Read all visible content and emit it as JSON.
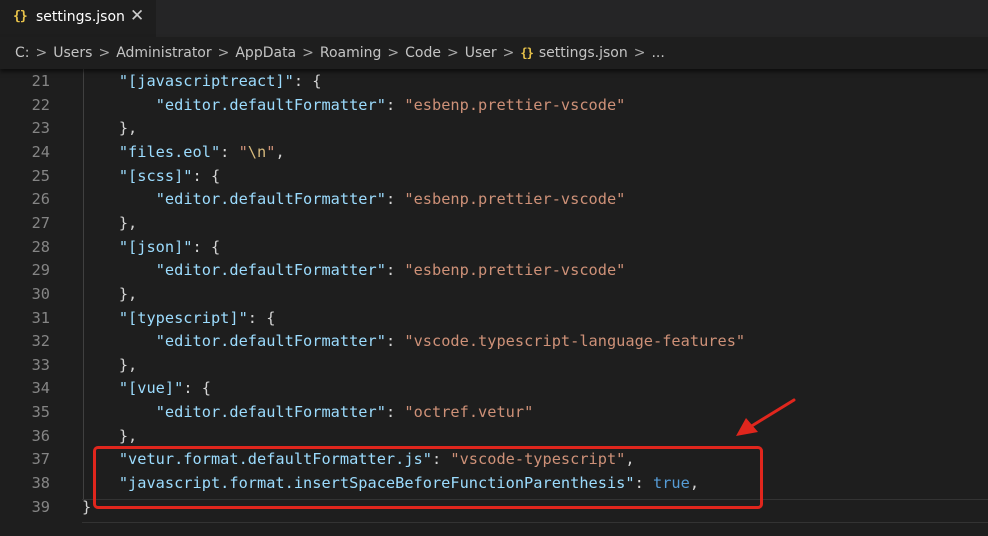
{
  "tab": {
    "icon": "{}",
    "label": "settings.json",
    "close_icon": "✕"
  },
  "breadcrumb": {
    "items": [
      "C:",
      "Users",
      "Administrator",
      "AppData",
      "Roaming",
      "Code",
      "User"
    ],
    "file_icon": "{}",
    "file": "settings.json",
    "more": "..."
  },
  "editor": {
    "lines": [
      {
        "n": "21",
        "tokens": [
          [
            "    ",
            "p"
          ],
          [
            "\"[javascriptreact]\"",
            "k"
          ],
          [
            ": {",
            "p"
          ]
        ]
      },
      {
        "n": "22",
        "tokens": [
          [
            "        ",
            "p"
          ],
          [
            "\"editor.defaultFormatter\"",
            "k"
          ],
          [
            ": ",
            "p"
          ],
          [
            "\"esbenp.prettier-vscode\"",
            "s"
          ]
        ]
      },
      {
        "n": "23",
        "tokens": [
          [
            "    },",
            "p"
          ]
        ]
      },
      {
        "n": "24",
        "tokens": [
          [
            "    ",
            "p"
          ],
          [
            "\"files.eol\"",
            "k"
          ],
          [
            ": ",
            "p"
          ],
          [
            "\"",
            "s"
          ],
          [
            "\\n",
            "e"
          ],
          [
            "\"",
            "s"
          ],
          [
            ",",
            "p"
          ]
        ]
      },
      {
        "n": "25",
        "tokens": [
          [
            "    ",
            "p"
          ],
          [
            "\"[scss]\"",
            "k"
          ],
          [
            ": {",
            "p"
          ]
        ]
      },
      {
        "n": "26",
        "tokens": [
          [
            "        ",
            "p"
          ],
          [
            "\"editor.defaultFormatter\"",
            "k"
          ],
          [
            ": ",
            "p"
          ],
          [
            "\"esbenp.prettier-vscode\"",
            "s"
          ]
        ]
      },
      {
        "n": "27",
        "tokens": [
          [
            "    },",
            "p"
          ]
        ]
      },
      {
        "n": "28",
        "tokens": [
          [
            "    ",
            "p"
          ],
          [
            "\"[json]\"",
            "k"
          ],
          [
            ": {",
            "p"
          ]
        ]
      },
      {
        "n": "29",
        "tokens": [
          [
            "        ",
            "p"
          ],
          [
            "\"editor.defaultFormatter\"",
            "k"
          ],
          [
            ": ",
            "p"
          ],
          [
            "\"esbenp.prettier-vscode\"",
            "s"
          ]
        ]
      },
      {
        "n": "30",
        "tokens": [
          [
            "    },",
            "p"
          ]
        ]
      },
      {
        "n": "31",
        "tokens": [
          [
            "    ",
            "p"
          ],
          [
            "\"[typescript]\"",
            "k"
          ],
          [
            ": {",
            "p"
          ]
        ]
      },
      {
        "n": "32",
        "tokens": [
          [
            "        ",
            "p"
          ],
          [
            "\"editor.defaultFormatter\"",
            "k"
          ],
          [
            ": ",
            "p"
          ],
          [
            "\"vscode.typescript-language-features\"",
            "s"
          ]
        ]
      },
      {
        "n": "33",
        "tokens": [
          [
            "    },",
            "p"
          ]
        ]
      },
      {
        "n": "34",
        "tokens": [
          [
            "    ",
            "p"
          ],
          [
            "\"[vue]\"",
            "k"
          ],
          [
            ": {",
            "p"
          ]
        ]
      },
      {
        "n": "35",
        "tokens": [
          [
            "        ",
            "p"
          ],
          [
            "\"editor.defaultFormatter\"",
            "k"
          ],
          [
            ": ",
            "p"
          ],
          [
            "\"octref.vetur\"",
            "s"
          ]
        ]
      },
      {
        "n": "36",
        "tokens": [
          [
            "    },",
            "p"
          ]
        ]
      },
      {
        "n": "37",
        "tokens": [
          [
            "    ",
            "p"
          ],
          [
            "\"vetur.format.defaultFormatter.js\"",
            "k"
          ],
          [
            ": ",
            "p"
          ],
          [
            "\"vscode-typescript\"",
            "s"
          ],
          [
            ",",
            "p"
          ]
        ]
      },
      {
        "n": "38",
        "tokens": [
          [
            "    ",
            "p"
          ],
          [
            "\"javascript.format.insertSpaceBeforeFunctionParenthesis\"",
            "k"
          ],
          [
            ": ",
            "p"
          ],
          [
            "true",
            "b"
          ],
          [
            ",",
            "p"
          ]
        ]
      },
      {
        "n": "39",
        "tokens": [
          [
            "}",
            "p"
          ]
        ]
      }
    ]
  },
  "colors": {
    "key": "#9cdcfe",
    "string": "#ce9178",
    "escape": "#d7ba7d",
    "boolean": "#569cd6",
    "punctuation": "#d4d4d4",
    "line_number": "#858585",
    "annotation": "#e0261d",
    "json_icon": "#e8c34a"
  },
  "annotation": {
    "box": "red-highlight-box",
    "arrow": "red-arrow"
  }
}
